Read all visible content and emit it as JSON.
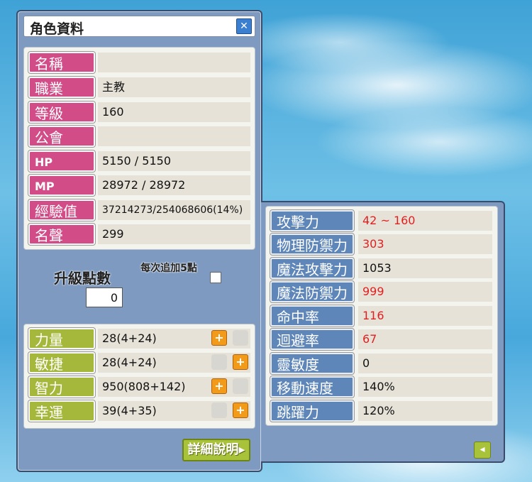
{
  "window": {
    "title": "角色資料",
    "close_icon": "close-icon"
  },
  "profile": [
    {
      "label": "名稱",
      "value": ""
    },
    {
      "label": "職業",
      "value": "主教"
    },
    {
      "label": "等級",
      "value": "160"
    },
    {
      "label": "公會",
      "value": ""
    },
    {
      "label": "HP",
      "value": "5150 / 5150"
    },
    {
      "label": "MP",
      "value": "28972 / 28972"
    },
    {
      "label": "經驗值",
      "value": "37214273/254068606(14%)"
    },
    {
      "label": "名聲",
      "value": "299"
    }
  ],
  "levelup": {
    "label": "升級點數",
    "points": "0",
    "auto_add_label": "每次追加5點",
    "auto_add_checked": false
  },
  "stats": [
    {
      "label": "力量",
      "value": "28(4+24)"
    },
    {
      "label": "敏捷",
      "value": "28(4+24)"
    },
    {
      "label": "智力",
      "value": "950(808+142)"
    },
    {
      "label": "幸運",
      "value": "39(4+35)"
    }
  ],
  "detail_button_label": "詳細說明",
  "detail_stats": [
    {
      "label": "攻擊力",
      "value": "42 ~ 160"
    },
    {
      "label": "物理防禦力",
      "value": "303"
    },
    {
      "label": "魔法攻擊力",
      "value": "1053"
    },
    {
      "label": "魔法防禦力",
      "value": "999"
    },
    {
      "label": "命中率",
      "value": "116"
    },
    {
      "label": "迴避率",
      "value": "67"
    },
    {
      "label": "靈敏度",
      "value": "0"
    },
    {
      "label": "移動速度",
      "value": "140%"
    },
    {
      "label": "跳躍力",
      "value": "120%"
    }
  ],
  "colors": {
    "label_pink": "#d24c88",
    "label_green": "#a6b83c",
    "label_blue": "#5e86b8",
    "value_red": "#e02020",
    "plus_orange": "#f29a1a"
  }
}
